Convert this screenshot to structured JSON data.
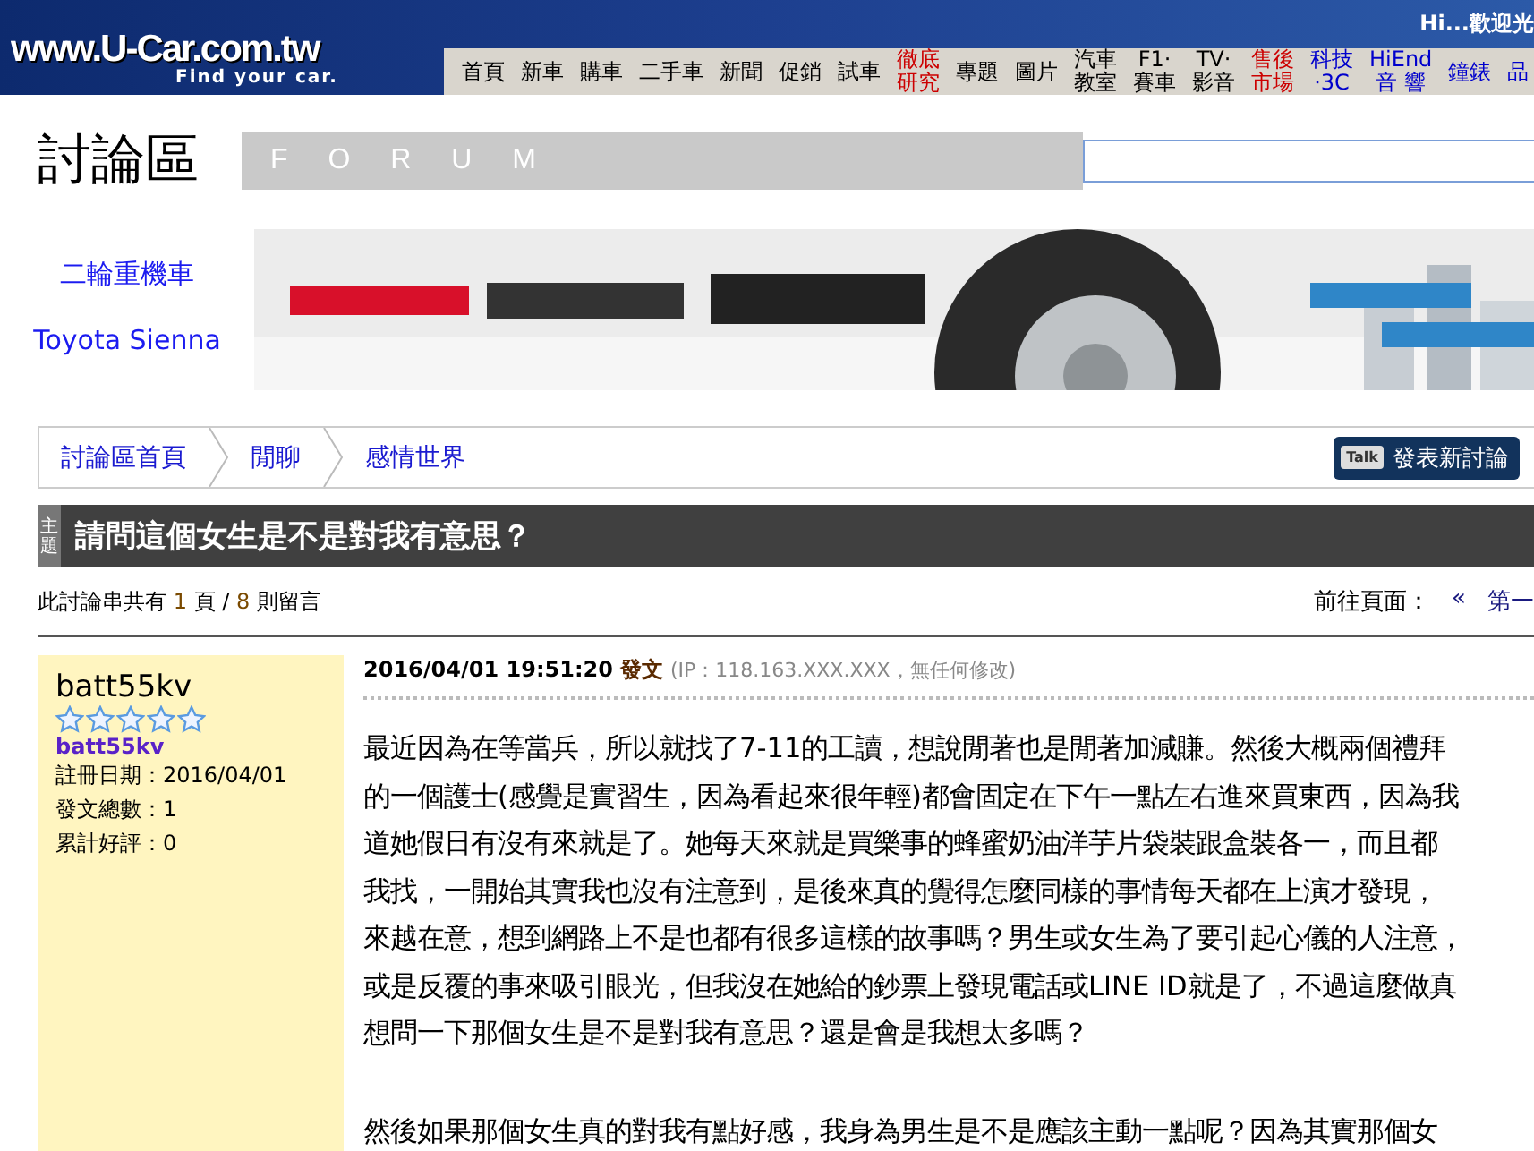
{
  "header": {
    "logo": "www.U-Car.com.tw",
    "tagline": "Find your car.",
    "greeting": "Hi...歡迎光"
  },
  "nav": [
    {
      "label": "首頁",
      "color": "#000000"
    },
    {
      "label": "新車",
      "color": "#000000"
    },
    {
      "label": "購車",
      "color": "#000000"
    },
    {
      "label": "二手車",
      "color": "#000000"
    },
    {
      "label": "新聞",
      "color": "#000000"
    },
    {
      "label": "促銷",
      "color": "#000000"
    },
    {
      "label": "試車",
      "color": "#000000"
    },
    {
      "label": "徹底研究",
      "color": "#cc0000",
      "kind": "stacked"
    },
    {
      "label": "專題",
      "color": "#000000"
    },
    {
      "label": "圖片",
      "color": "#000000"
    },
    {
      "label": "汽車教室",
      "color": "#000000",
      "kind": "stacked"
    },
    {
      "label": "F1·\n賽車",
      "color": "#000000"
    },
    {
      "label": "TV·\n影音",
      "color": "#000000"
    },
    {
      "label": "售後市場",
      "color": "#cc0000",
      "kind": "stacked"
    },
    {
      "label": "科技\n·3C",
      "color": "#0000cc"
    },
    {
      "label": "HiEnd\n音 響",
      "color": "#0000cc"
    },
    {
      "label": "鐘錶",
      "color": "#0000cc"
    },
    {
      "label": "品",
      "color": "#0000cc"
    }
  ],
  "forum": {
    "title": "討論區",
    "subtitle": "F O R U M"
  },
  "sidebar": {
    "links": [
      "二輪重機車",
      "Toyota Sienna"
    ]
  },
  "breadcrumb": [
    "討論區首頁",
    "閒聊",
    "感情世界"
  ],
  "new_topic_button": {
    "icon_text": "Talk",
    "label": "發表新討論"
  },
  "topic": {
    "badge": "主題",
    "title": "請問這個女生是不是對我有意思？"
  },
  "stats": [
    {
      "kind": "label",
      "text": "此討論串共有 "
    },
    {
      "kind": "number",
      "text": "1"
    },
    {
      "kind": "label",
      "text": " 頁 / "
    },
    {
      "kind": "number",
      "text": "8"
    },
    {
      "kind": "label",
      "text": " 則留言"
    }
  ],
  "pager": {
    "label": "前往頁面：",
    "prev": "«",
    "first": "第一"
  },
  "post": {
    "author": {
      "name": "batt55kv",
      "stars": 0,
      "link": "batt55kv",
      "info": [
        "註冊日期：2016/04/01",
        "發文總數：1",
        "累計好評：0"
      ]
    },
    "time": "2016/04/01 19:51:20",
    "action": "發文",
    "ip": "(IP：118.163.XXX.XXX，無任何修改)",
    "paragraphs": [
      [
        "最近因為在等當兵，所以就找了7-11的工讀，想說閒著也是閒著加減賺。然後大概兩個禮拜",
        "的一個護士(感覺是實習生，因為看起來很年輕)都會固定在下午一點左右進來買東西，因為我",
        "道她假日有沒有來就是了。她每天來就是買樂事的蜂蜜奶油洋芋片袋裝跟盒裝各一，而且都",
        "我找，一開始其實我也沒有注意到，是後來真的覺得怎麼同樣的事情每天都在上演才發現，",
        "來越在意，想到網路上不是也都有很多這樣的故事嗎？男生或女生為了要引起心儀的人注意，",
        "或是反覆的事來吸引眼光，但我沒在她給的鈔票上發現電話或LINE ID就是了，不過這麼做真",
        "想問一下那個女生是不是對我有意思？還是會是我想太多嗎？"
      ],
      [
        "然後如果那個女生真的對我有點好感，我身為男生是不是應該主動一點呢？因為其實那個女"
      ]
    ]
  }
}
